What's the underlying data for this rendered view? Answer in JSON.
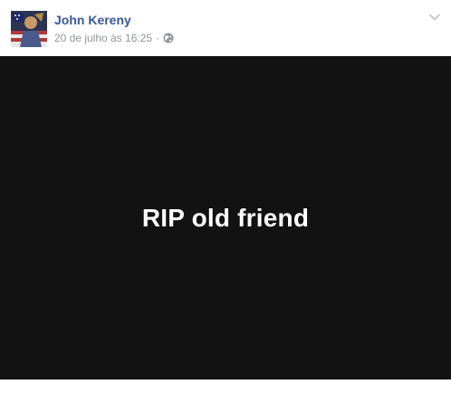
{
  "post": {
    "author_name": "John Kereny",
    "timestamp": "20 de julho às 16:25",
    "separator": "·",
    "privacy_icon": "globe-icon",
    "menu_icon": "chevron-down-icon",
    "media_text": "RIP old friend",
    "media_background": "#121212",
    "author_color": "#365899",
    "meta_color": "#90949c"
  }
}
